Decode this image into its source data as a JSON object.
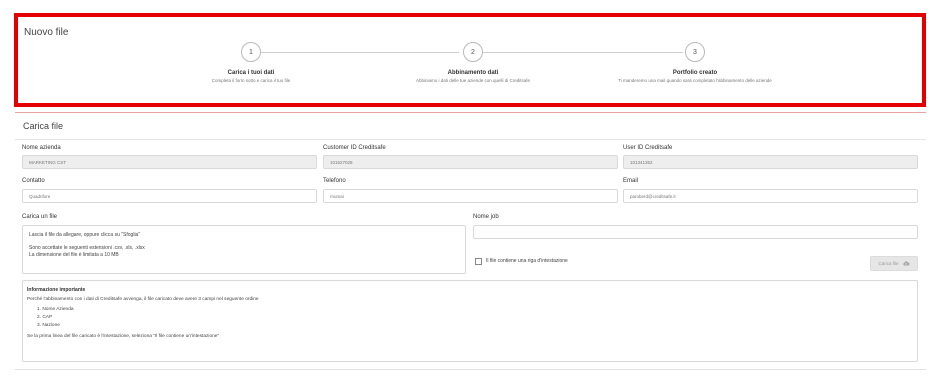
{
  "stepper": {
    "title": "Nuovo file",
    "steps": [
      {
        "number": "1",
        "label": "Carica i tuoi dati",
        "description": "Completa il form sotto e carica il tuo file"
      },
      {
        "number": "2",
        "label": "Abbinamento dati",
        "description": "Abbiniamo i dati delle tue aziende con quelli di Creditsafe"
      },
      {
        "number": "3",
        "label": "Portfolio creato",
        "description": "Ti manderemo una mail quando sarà completato l'abbinamento delle aziende"
      }
    ]
  },
  "upload": {
    "title": "Carica file",
    "fields": {
      "company_name": {
        "label": "Nome azienda",
        "value": "MARKETING CST"
      },
      "customer_id": {
        "label": "Customer ID Creditsafe",
        "value": "101627028"
      },
      "user_id": {
        "label": "User ID Creditsafe",
        "value": "101341352"
      },
      "contact": {
        "label": "Contatto",
        "value": "Quadrifore"
      },
      "phone": {
        "label": "Telefono",
        "value": "rnumai"
      },
      "email": {
        "label": "Email",
        "value": "paroberd@creditsafe.it"
      },
      "job_name": {
        "label": "Nome job",
        "value": ""
      }
    },
    "file_label": "Carica un file",
    "dropzone": {
      "instruction": "Lascia il file da allegare, oppure clicca su \"Sfoglia\"",
      "formats": "Sono accettate le seguenti estensioni .csv, .xls, .xlsx",
      "size_limit": "La dimensione del file è limitata a 10 MB"
    },
    "header_checkbox_label": "Il file contiene una riga d'intestazione",
    "upload_button_label": "Carica file",
    "info": {
      "title": "Informazione importante",
      "text": "Perché l'abbinamento con i dati di Creditsafe avvenga, il file caricato deve avere 3 campi nel seguente ordine",
      "items": [
        "1. Nome Azienda",
        "2. CAP",
        "3. Nazione"
      ],
      "footer": "Se la prima linea del file caricato è l'intestazione, seleziona \"Il file contiene un'intestazione\""
    }
  },
  "colors": {
    "highlight_border": "#e50000",
    "readonly_bg": "#eeeeee",
    "disabled_button": "#e6e6e6"
  },
  "icons": {
    "upload_button": "cloud-upload-icon"
  }
}
